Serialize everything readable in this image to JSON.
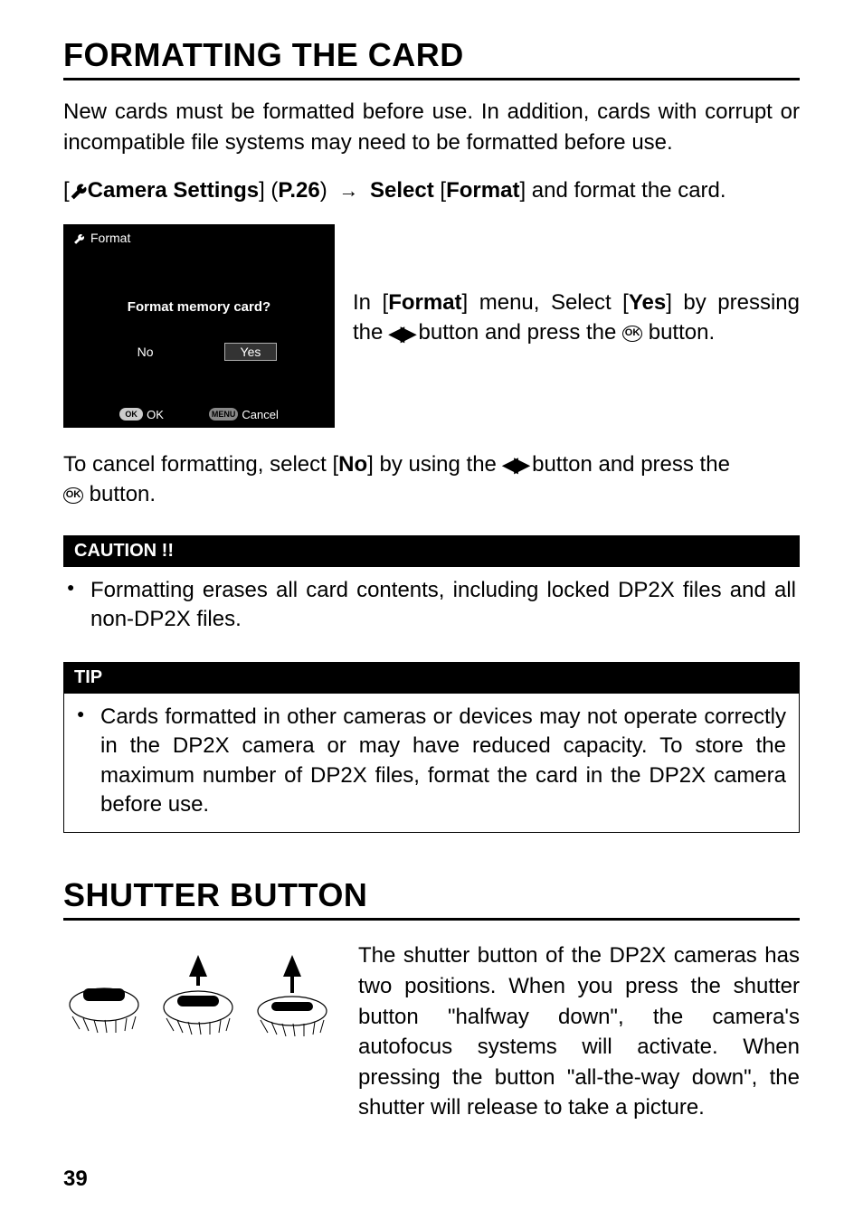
{
  "page_number": "39",
  "section1": {
    "heading": "FORMATTING THE CARD",
    "intro": "New cards must be formatted before use. In addition, cards with corrupt or incompatible file systems may need to be formatted before use.",
    "instruction": {
      "prefix": "[",
      "camera_settings": "Camera Settings",
      "bracket": "] (",
      "pageref": "P.26",
      "midsep": ")  ",
      "select_word": "Select",
      "open2": " [",
      "format_word": "Format",
      "close2": "] and format the card."
    },
    "lcd": {
      "title": "Format",
      "prompt": "Format memory card?",
      "no": "No",
      "yes": "Yes",
      "ok_label": "OK",
      "cancel_label": "Cancel",
      "ok_btn": "OK",
      "menu_btn": "MENU"
    },
    "side_text": {
      "part1": "In [",
      "format_bold": "Format",
      "part2": "] menu, Select [",
      "yes_bold": "Yes",
      "part3": "] by pressing the ",
      "part4": " button and press the ",
      "part5": " button."
    },
    "cancel_text": {
      "part1": "To cancel formatting, select [",
      "no_bold": "No",
      "part2": "] by using the ",
      "part3": " button and press the ",
      "part4": " button."
    },
    "caution_label": "CAUTION !!",
    "caution_bullet": "Formatting erases all card contents, including locked DP2X files and all non-DP2X files.",
    "tip_label": "TIP",
    "tip_bullet": "Cards formatted in other cameras or devices may not operate correctly in the DP2X camera or may have reduced capacity. To store the maximum number of DP2X files, format the card in the DP2X camera before use."
  },
  "section2": {
    "heading": "SHUTTER BUTTON",
    "body": "The shutter button of the DP2X cameras has two positions. When you press the shutter button \"halfway down\", the camera's autofocus systems will activate. When pressing the button \"all-the-way down\", the shutter will release to take a picture."
  },
  "icons": {
    "wrench": "wrench-icon",
    "arrow_right": "arrow-right-icon",
    "lr_buttons": "left-right-icon",
    "ok_circle": "ok-circle-icon"
  }
}
